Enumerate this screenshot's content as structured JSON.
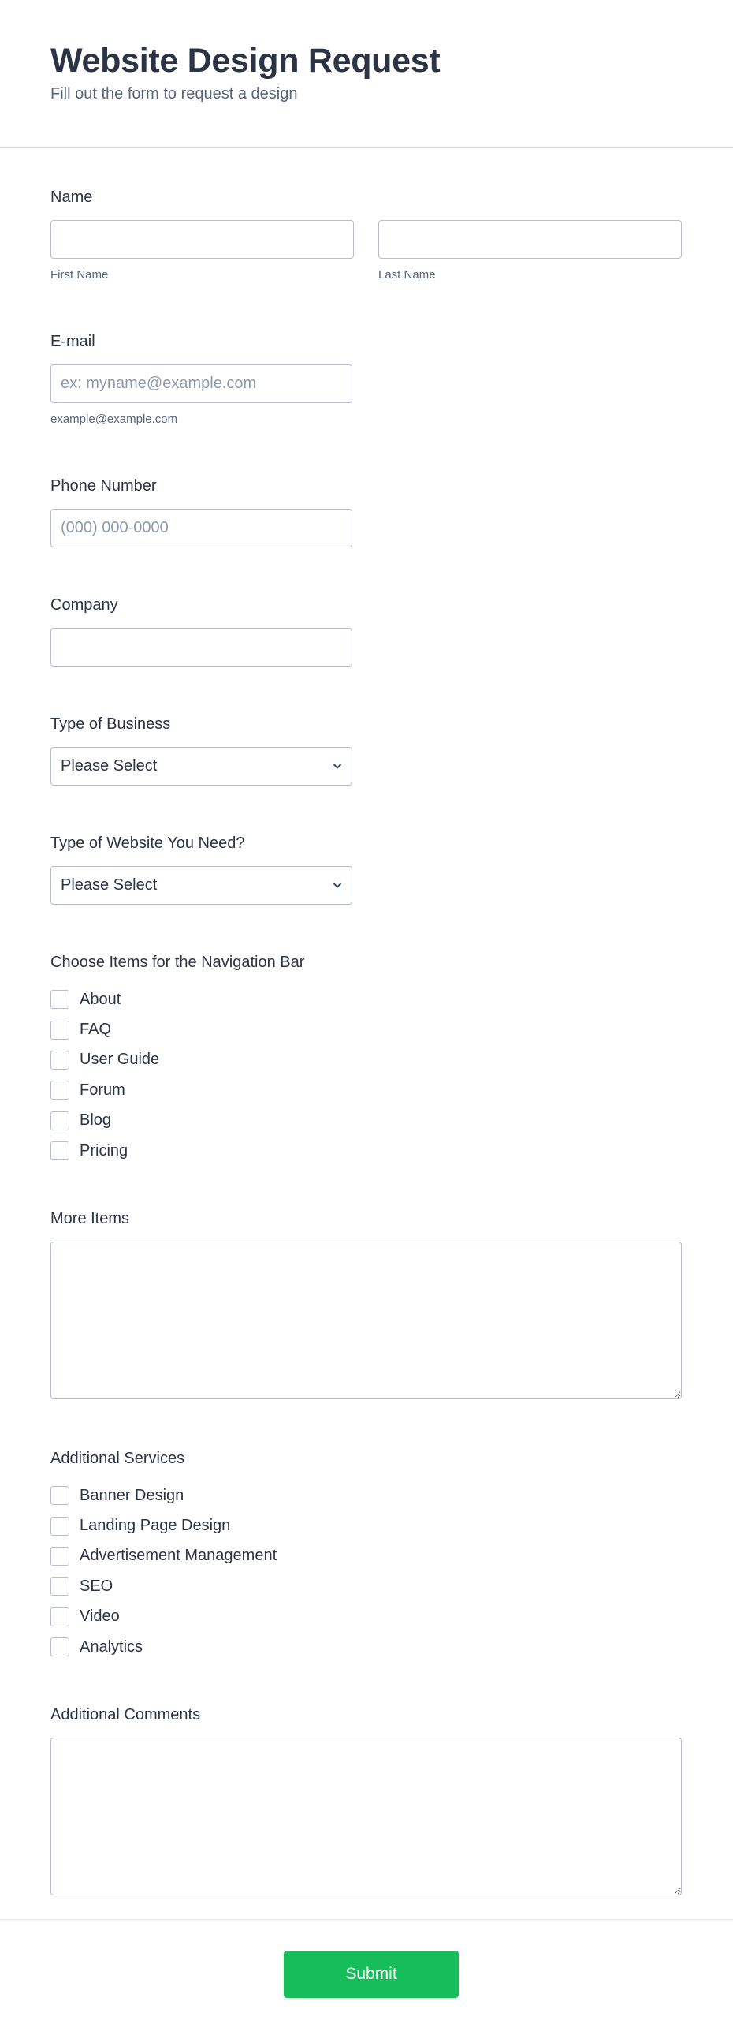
{
  "header": {
    "title": "Website Design Request",
    "subtitle": "Fill out the form to request a design"
  },
  "fields": {
    "name": {
      "label": "Name",
      "first": {
        "value": "",
        "sublabel": "First Name"
      },
      "last": {
        "value": "",
        "sublabel": "Last Name"
      }
    },
    "email": {
      "label": "E-mail",
      "value": "",
      "placeholder": "ex: myname@example.com",
      "sublabel": "example@example.com"
    },
    "phone": {
      "label": "Phone Number",
      "value": "",
      "placeholder": "(000) 000-0000"
    },
    "company": {
      "label": "Company",
      "value": ""
    },
    "business_type": {
      "label": "Type of Business",
      "selected": "Please Select"
    },
    "website_type": {
      "label": "Type of Website You Need?",
      "selected": "Please Select"
    },
    "nav_items": {
      "label": "Choose Items for the Navigation Bar",
      "options": [
        {
          "label": "About",
          "checked": false
        },
        {
          "label": "FAQ",
          "checked": false
        },
        {
          "label": "User Guide",
          "checked": false
        },
        {
          "label": "Forum",
          "checked": false
        },
        {
          "label": "Blog",
          "checked": false
        },
        {
          "label": "Pricing",
          "checked": false
        }
      ]
    },
    "more_items": {
      "label": "More Items",
      "value": ""
    },
    "services": {
      "label": "Additional Services",
      "options": [
        {
          "label": "Banner Design",
          "checked": false
        },
        {
          "label": "Landing Page Design",
          "checked": false
        },
        {
          "label": "Advertisement Management",
          "checked": false
        },
        {
          "label": "SEO",
          "checked": false
        },
        {
          "label": "Video",
          "checked": false
        },
        {
          "label": "Analytics",
          "checked": false
        }
      ]
    },
    "comments": {
      "label": "Additional Comments",
      "value": ""
    }
  },
  "submit": {
    "label": "Submit"
  },
  "colors": {
    "accent": "#18bd5b",
    "text": "#2c3345",
    "muted": "#57647e",
    "border": "#b8bdc9"
  }
}
